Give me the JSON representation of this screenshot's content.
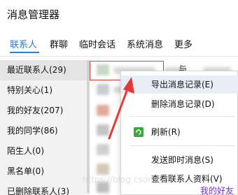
{
  "window": {
    "title": "消息管理器"
  },
  "tabs": [
    {
      "label": "联系人"
    },
    {
      "label": "群聊"
    },
    {
      "label": "临时会话"
    },
    {
      "label": "系统消息"
    },
    {
      "label": "更多"
    }
  ],
  "sidebar": {
    "items": [
      {
        "label": "最近联系人(29)"
      },
      {
        "label": "特别关心(1)"
      },
      {
        "label": "我的好友(207)"
      },
      {
        "label": "我的同学(86)"
      },
      {
        "label": "陌生人(0)"
      },
      {
        "label": "黑名单(0)"
      },
      {
        "label": "已删除联系人(3)"
      }
    ]
  },
  "context_menu": {
    "items": [
      {
        "label": "导出消息记录(E)"
      },
      {
        "label": "删除消息记录(D)"
      },
      {
        "label": "刷新(R)",
        "icon": "refresh-icon"
      },
      {
        "label": "发送即时消息(S)"
      },
      {
        "label": "查看联系人资料(V)"
      }
    ]
  },
  "list": {
    "partial_text": "与"
  },
  "watermark": {
    "text": "https://blog.csdn.net/..."
  },
  "bottom_snippet": {
    "text": "我的好友"
  },
  "colors": {
    "accent": "#2a7ae2",
    "annotation_red": "#e53935"
  }
}
